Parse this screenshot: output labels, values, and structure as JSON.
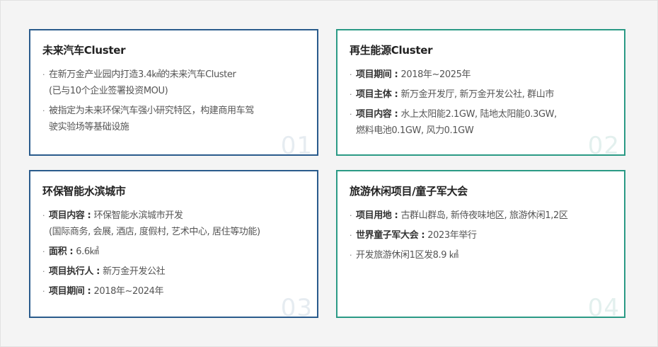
{
  "cards": [
    {
      "title": "未来汽车Cluster",
      "number": "01",
      "items": [
        {
          "key": "",
          "lines": [
            "在新万金产业园内打造3.4㎢的未来汽车Cluster",
            "(已与10个企业签署投资MOU)"
          ]
        },
        {
          "key": "",
          "lines": [
            "被指定为未来环保汽车强小研究特区，构建商用车驾",
            "驶实验场等基础设施"
          ]
        }
      ]
    },
    {
      "title": "再生能源Cluster",
      "number": "02",
      "items": [
        {
          "key": "项目期间 : ",
          "lines": [
            "2018年~2025年"
          ]
        },
        {
          "key": "项目主体 : ",
          "lines": [
            "新万金开发厅, 新万金开发公社, 群山市"
          ]
        },
        {
          "key": "项目内容 : ",
          "lines": [
            "水上太阳能2.1GW, 陆地太阳能0.3GW,",
            "燃料电池0.1GW, 风力0.1GW"
          ]
        }
      ]
    },
    {
      "title": "环保智能水滨城市",
      "number": "03",
      "items": [
        {
          "key": "项目内容 : ",
          "lines": [
            "环保智能水滨城市开发",
            "(国际商务, 会展, 酒店, 度假村, 艺术中心, 居住等功能)"
          ]
        },
        {
          "key": "面积 : ",
          "lines": [
            "6.6㎢"
          ]
        },
        {
          "key": "项目执行人 : ",
          "lines": [
            "新万金开发公社"
          ]
        },
        {
          "key": "项目期间 : ",
          "lines": [
            "2018年~2024年"
          ]
        }
      ]
    },
    {
      "title": "旅游休闲项目/童子军大会",
      "number": "04",
      "items": [
        {
          "key": "项目用地 : ",
          "lines": [
            "古群山群岛, 新侍夜味地区, 旅游休闲1,2区"
          ]
        },
        {
          "key": "世界童子军大会 : ",
          "lines": [
            "2023年举行"
          ]
        },
        {
          "key": "",
          "lines": [
            "开发旅游休闲1区发8.9 ㎢"
          ]
        }
      ]
    }
  ],
  "colors": {
    "blue_border": "#2a5b8c",
    "green_border": "#2b9a85"
  }
}
